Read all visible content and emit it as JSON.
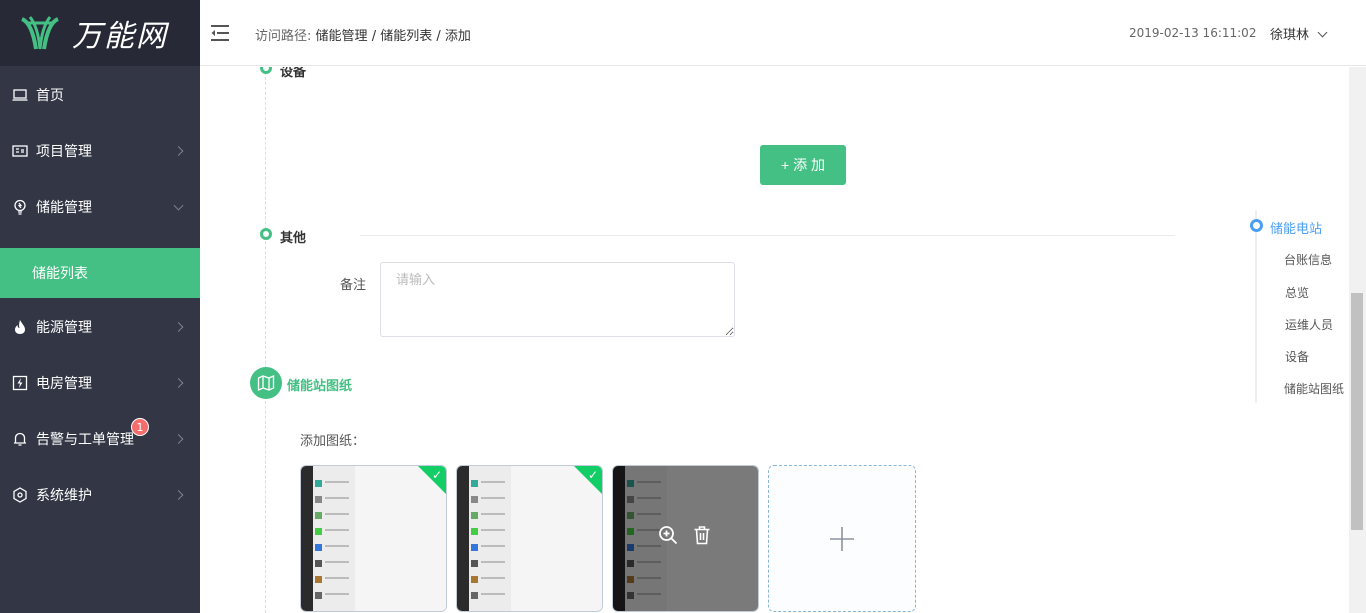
{
  "app": {
    "logo_text": "万能网"
  },
  "sidebar": {
    "items": [
      {
        "label": "首页"
      },
      {
        "label": "项目管理"
      },
      {
        "label": "储能管理"
      },
      {
        "label": "储能列表"
      },
      {
        "label": "能源管理"
      },
      {
        "label": "电房管理"
      },
      {
        "label": "告警与工单管理",
        "badge": "1"
      },
      {
        "label": "系统维护"
      }
    ]
  },
  "header": {
    "breadcrumb_prefix": "访问路径:",
    "breadcrumb": [
      "储能管理",
      "储能列表",
      "添加"
    ],
    "separator": "/",
    "datetime": "2019-02-13 16:11:02",
    "user": "徐琪林"
  },
  "main": {
    "section_device": "设备",
    "add_button": "+ 添 加",
    "section_other": "其他",
    "remark_label": "备注",
    "remark_placeholder": "请输入",
    "drawing_title": "储能站图纸",
    "add_drawing_label": "添加图纸："
  },
  "anchor_nav": {
    "items": [
      "储能电站",
      "台账信息",
      "总览",
      "运维人员",
      "设备",
      "储能站图纸"
    ]
  },
  "colors": {
    "accent": "#45c084",
    "sidebar": "#323645",
    "link": "#4a9ff5"
  }
}
